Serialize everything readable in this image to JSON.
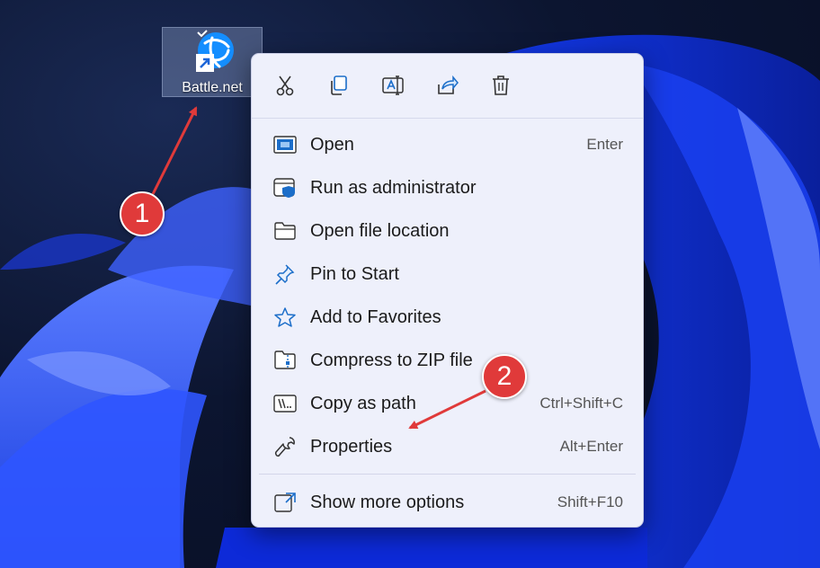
{
  "desktop": {
    "shortcut_label": "Battle.net",
    "shortcut_icon": "battlenet-app-icon"
  },
  "context_menu": {
    "toolbar": [
      {
        "icon": "cut-icon"
      },
      {
        "icon": "copy-icon"
      },
      {
        "icon": "rename-icon"
      },
      {
        "icon": "share-icon"
      },
      {
        "icon": "delete-icon"
      }
    ],
    "items": [
      {
        "label": "Open",
        "shortcut": "Enter",
        "icon": "open-icon"
      },
      {
        "label": "Run as administrator",
        "shortcut": "",
        "icon": "admin-shield-icon"
      },
      {
        "label": "Open file location",
        "shortcut": "",
        "icon": "folder-icon"
      },
      {
        "label": "Pin to Start",
        "shortcut": "",
        "icon": "pin-icon"
      },
      {
        "label": "Add to Favorites",
        "shortcut": "",
        "icon": "star-icon"
      },
      {
        "label": "Compress to ZIP file",
        "shortcut": "",
        "icon": "zip-icon"
      },
      {
        "label": "Copy as path",
        "shortcut": "Ctrl+Shift+C",
        "icon": "copy-path-icon"
      },
      {
        "label": "Properties",
        "shortcut": "Alt+Enter",
        "icon": "wrench-icon"
      }
    ],
    "more": {
      "label": "Show more options",
      "shortcut": "Shift+F10",
      "icon": "show-more-icon"
    }
  },
  "annotations": {
    "badge_1": "1",
    "badge_2": "2",
    "color": "#e03a3a"
  }
}
